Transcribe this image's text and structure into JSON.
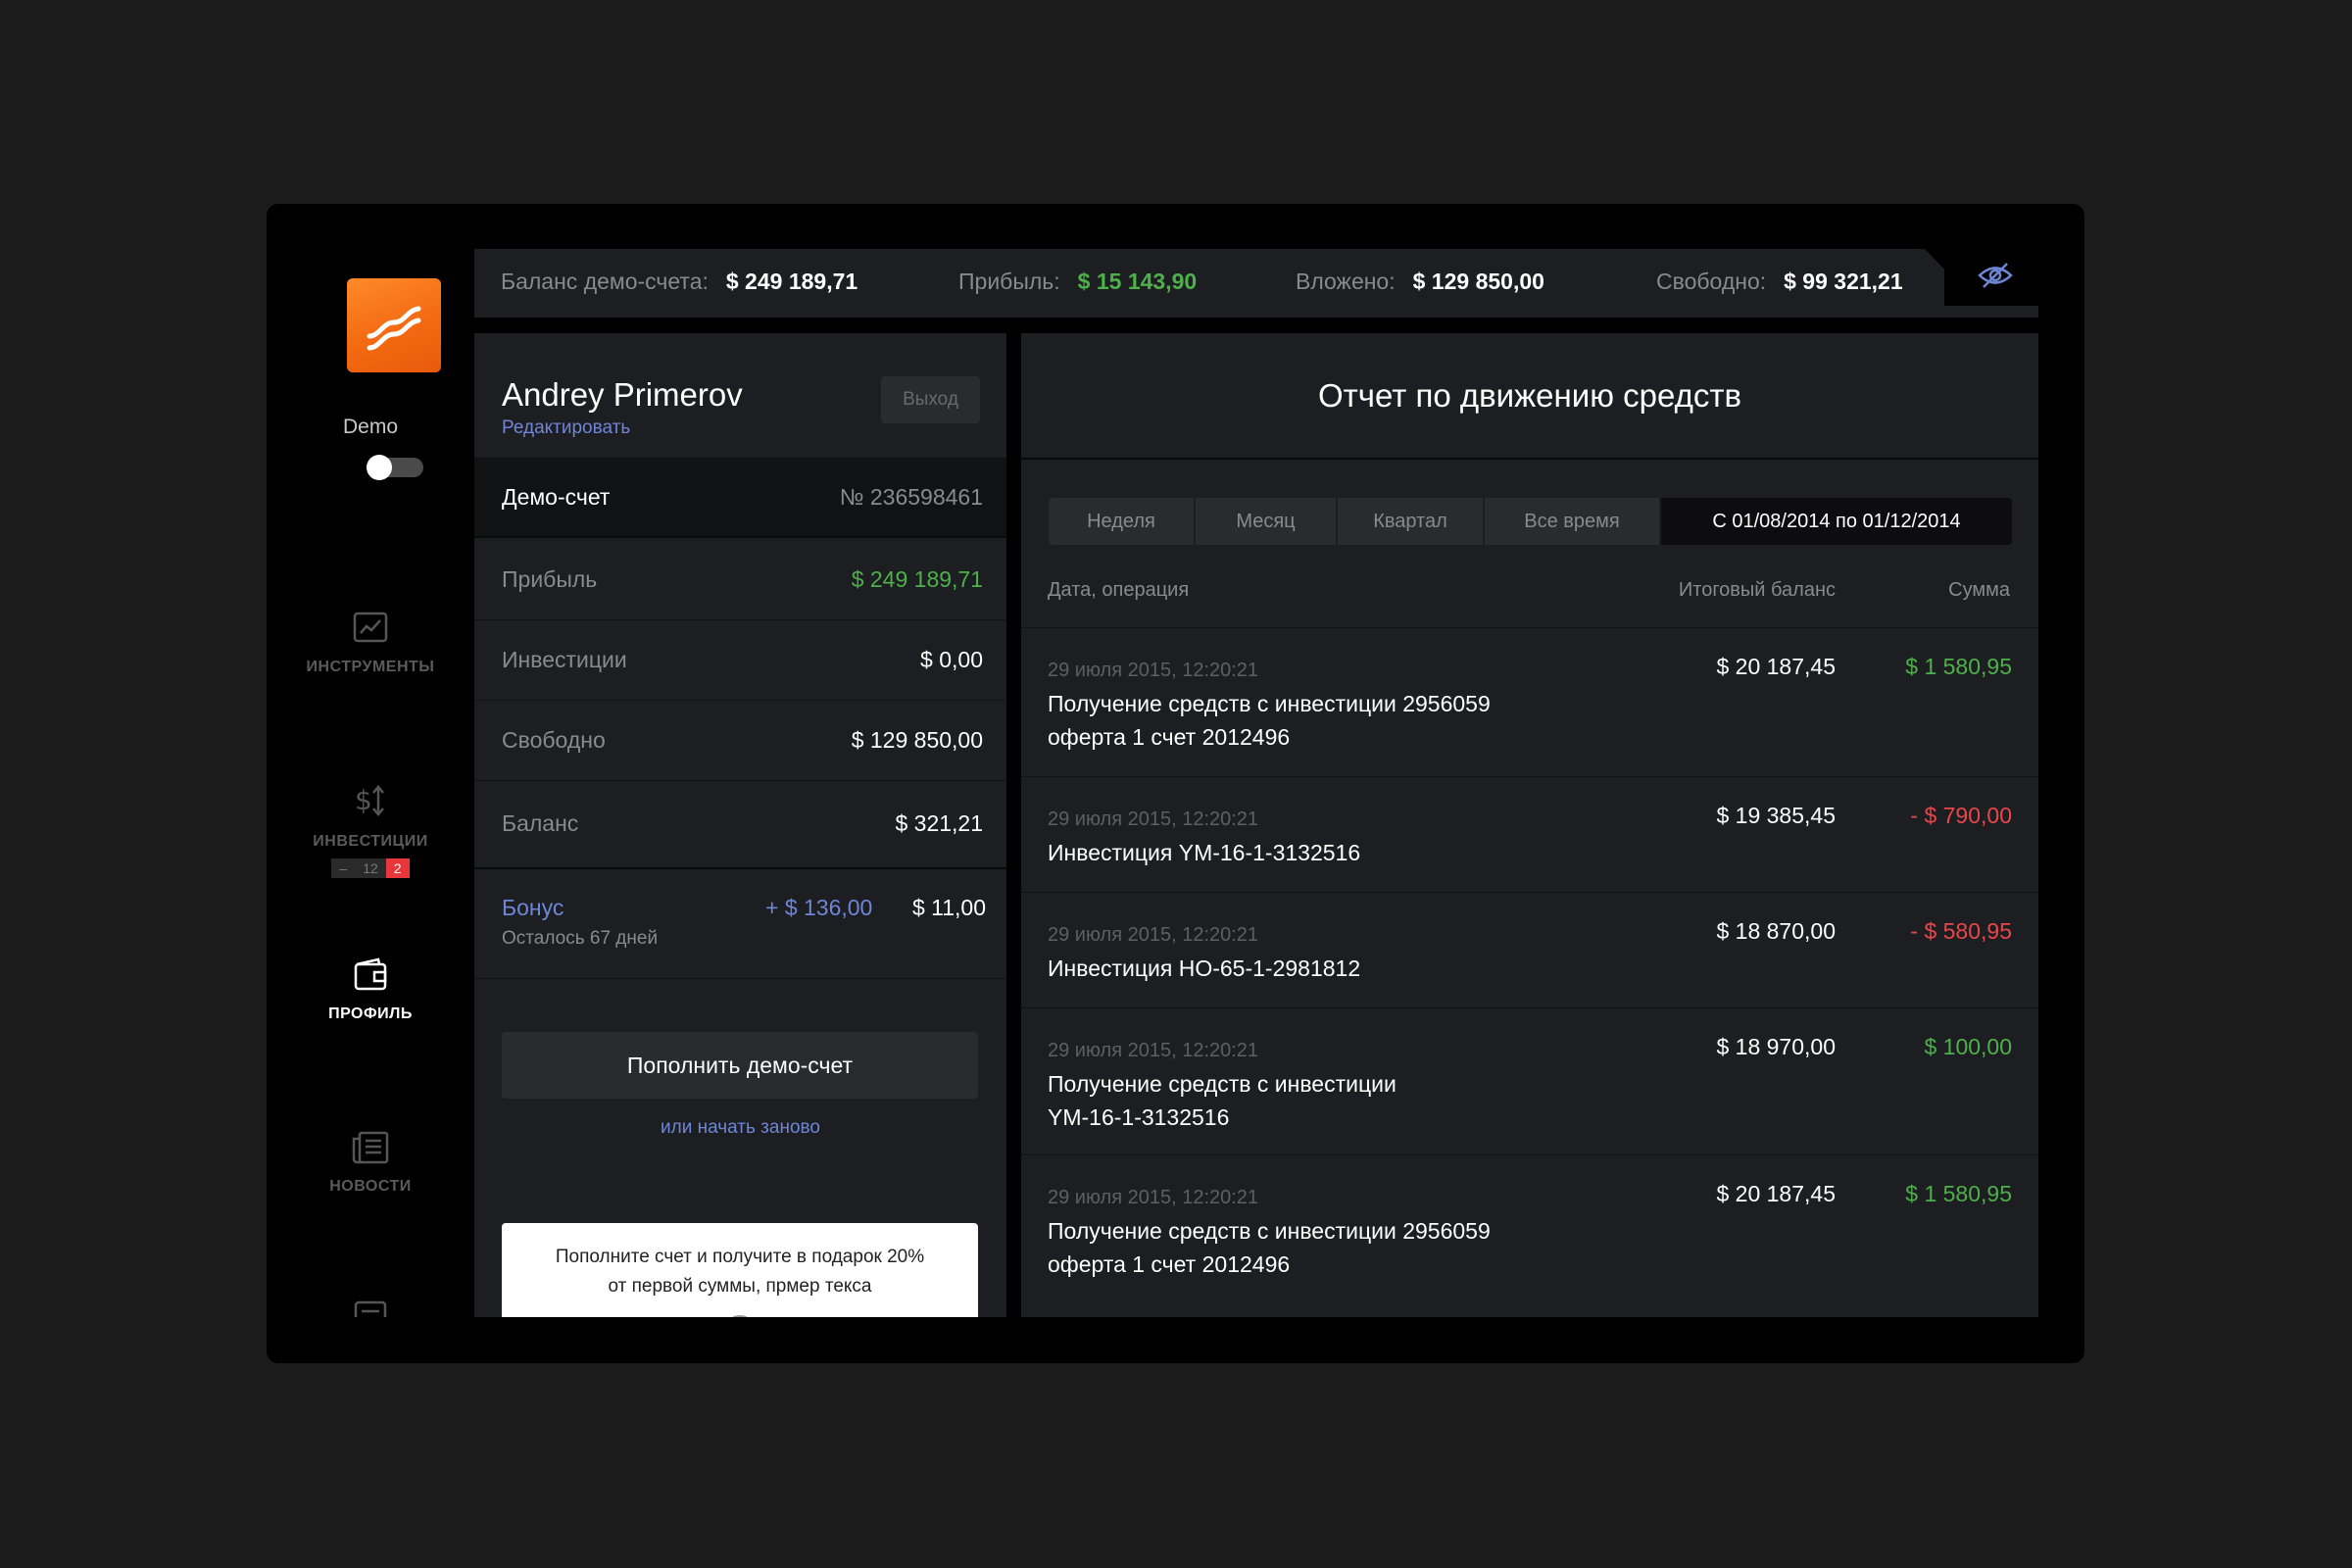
{
  "sidebar": {
    "demo_label": "Demo",
    "demo_toggle_on": false,
    "nav": [
      {
        "label": "ИНСТРУМЕНТЫ",
        "icon": "chart-icon",
        "active": false
      },
      {
        "label": "ИНВЕСТИЦИИ",
        "icon": "dollar-exchange-icon",
        "active": false,
        "badges": [
          "–",
          "12",
          "2"
        ]
      },
      {
        "label": "ПРОФИЛЬ",
        "icon": "wallet-icon",
        "active": true
      },
      {
        "label": "НОВОСТИ",
        "icon": "news-icon",
        "active": false
      }
    ]
  },
  "topbar": {
    "balance_label": "Баланс демо-счета:",
    "balance_value": "$ 249 189,71",
    "profit_label": "Прибыль:",
    "profit_value": "$ 15 143,90",
    "invested_label": "Вложено:",
    "invested_value": "$ 129 850,00",
    "free_label": "Свободно:",
    "free_value": "$ 99 321,21",
    "visibility_icon": "eye-hidden-icon"
  },
  "profile": {
    "user_name": "Andrey Primerov",
    "edit_label": "Редактировать",
    "logout_label": "Выход",
    "account_label": "Демо-счет",
    "account_number": "№ 236598461",
    "stats": [
      {
        "label": "Прибыль",
        "value": "$ 249 189,71",
        "tone": "green"
      },
      {
        "label": "Инвестиции",
        "value": "$ 0,00",
        "tone": "white"
      },
      {
        "label": "Свободно",
        "value": "$ 129 850,00",
        "tone": "white"
      },
      {
        "label": "Баланс",
        "value": "$ 321,21",
        "tone": "white"
      }
    ],
    "bonus": {
      "label": "Бонус",
      "sub": "Осталось 67 дней",
      "plus": "+ $ 136,00",
      "value": "$ 11,00"
    },
    "topup_label": "Пополнить демо-счет",
    "restart_label": "или начать заново",
    "promo_line1": "Пополните счет и получите в подарок 20%",
    "promo_line2": "от первой суммы, прмер текса"
  },
  "report": {
    "title": "Отчет по движению средств",
    "periods": [
      {
        "label": "Неделя",
        "active": false
      },
      {
        "label": "Месяц",
        "active": false
      },
      {
        "label": "Квартал",
        "active": false
      },
      {
        "label": "Все время",
        "active": false
      },
      {
        "label": "С 01/08/2014 по 01/12/2014",
        "active": true
      }
    ],
    "columns": {
      "operation": "Дата, операция",
      "balance": "Итоговый баланс",
      "amount": "Сумма"
    },
    "rows": [
      {
        "date": "29 июля 2015, 12:20:21",
        "desc_lines": [
          "Получение средств с инвестиции 2956059",
          "оферта 1 счет 2012496"
        ],
        "balance": "$ 20 187,45",
        "amount": "$ 1 580,95",
        "tone": "green"
      },
      {
        "date": "29 июля 2015, 12:20:21",
        "desc_lines": [
          "Инвестиция YM-16-1-3132516"
        ],
        "balance": "$ 19 385,45",
        "amount": "- $ 790,00",
        "tone": "red"
      },
      {
        "date": "29 июля 2015, 12:20:21",
        "desc_lines": [
          "Инвестиция НО-65-1-2981812"
        ],
        "balance": "$ 18 870,00",
        "amount": "- $ 580,95",
        "tone": "red"
      },
      {
        "date": "29 июля 2015, 12:20:21",
        "desc_lines": [
          "Получение средств с инвестиции",
          "YM-16-1-3132516"
        ],
        "balance": "$ 18 970,00",
        "amount": "$ 100,00",
        "tone": "green"
      },
      {
        "date": "29 июля 2015, 12:20:21",
        "desc_lines": [
          "Получение средств с инвестиции 2956059",
          "оферта 1 счет 2012496"
        ],
        "balance": "$ 20 187,45",
        "amount": "$ 1 580,95",
        "tone": "green"
      }
    ]
  },
  "colors": {
    "accent_orange": "#f36a12",
    "positive": "#4eb04a",
    "negative": "#e8474a",
    "link": "#6e86d6",
    "panel": "#1d1e21"
  }
}
